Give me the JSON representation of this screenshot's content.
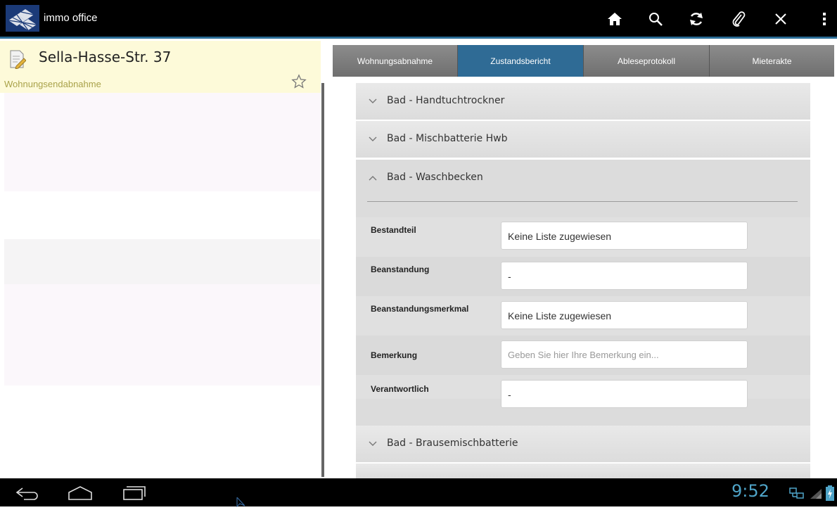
{
  "app": {
    "title": "immo office"
  },
  "toolbar": {
    "icons": [
      "home-icon",
      "search-icon",
      "refresh-icon",
      "paperclip-icon",
      "close-icon",
      "overflow-menu-icon"
    ]
  },
  "left": {
    "address": "Sella-Hasse-Str. 37",
    "subtitle": "Wohnungsendabnahme"
  },
  "tabs": [
    {
      "label": "Wohnungsabnahme",
      "active": false
    },
    {
      "label": "Zustandsbericht",
      "active": true
    },
    {
      "label": "Ableseprotokoll",
      "active": false
    },
    {
      "label": "Mieterakte",
      "active": false
    }
  ],
  "sections": [
    {
      "title": "Bad - Handtuchtrockner",
      "expanded": false
    },
    {
      "title": "Bad - Mischbatterie Hwb",
      "expanded": false
    },
    {
      "title": "Bad - Waschbecken",
      "expanded": true
    },
    {
      "title": "Bad - Brausemischbatterie",
      "expanded": false
    }
  ],
  "fields": [
    {
      "label": "Bestandteil",
      "value": "Keine Liste zugewiesen"
    },
    {
      "label": "Beanstandung",
      "value": "-"
    },
    {
      "label": "Beanstandungsmerkmal",
      "value": "Keine Liste zugewiesen"
    },
    {
      "label": "Bemerkung",
      "value": "",
      "placeholder": "Geben Sie hier Ihre Bemerkung ein..."
    },
    {
      "label": "Verantwortlich",
      "value": "-"
    }
  ],
  "status": {
    "time": "9:52"
  },
  "colors": {
    "accent": "#2f6b95",
    "header_bg": "#fdfad9",
    "clock": "#4fa4c8"
  }
}
